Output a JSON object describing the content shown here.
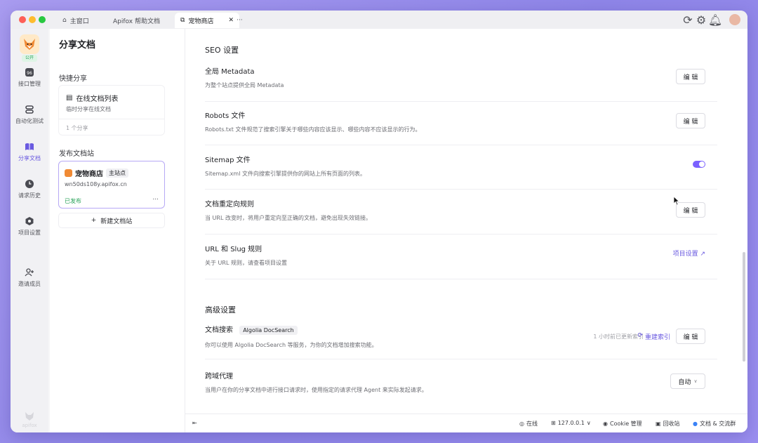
{
  "tabs": {
    "home": "主窗口",
    "help": "Apifox 帮助文档",
    "shop": "宠物商店"
  },
  "rail": {
    "badge": "公开",
    "items": [
      "接口管理",
      "自动化测试",
      "分享文档",
      "请求历史",
      "项目设置",
      "邀请成员"
    ],
    "footer": "apifox"
  },
  "sidebar": {
    "title": "分享文档",
    "quick_share": "快捷分享",
    "online_list_title": "在线文档列表",
    "online_list_desc": "临时分享在线文档",
    "share_count": "1 个分享",
    "publish_title": "发布文档站",
    "site_name": "宠物商店",
    "site_badge": "主站点",
    "site_url": "wn50ds108y.apifox.cn",
    "site_status": "已发布",
    "more": "...",
    "new_site": "新建文档站"
  },
  "main": {
    "seo_title": "SEO 设置",
    "rows": [
      {
        "title": "全局 Metadata",
        "desc": "为整个站点提供全局 Metadata",
        "action": "编 辑"
      },
      {
        "title": "Robots 文件",
        "desc": "Robots.txt 文件规范了搜索引擎关于哪些内容应该显示、哪些内容不应该显示的行为。",
        "action": "编 辑"
      },
      {
        "title": "Sitemap 文件",
        "desc": "Sitemap.xml 文件向搜索引擎提供你的网站上所有页面的列表。",
        "toggle": true
      },
      {
        "title": "文档重定向规则",
        "desc": "当 URL 改变时，将用户重定向至正确的文档，避免出现失效链接。",
        "action": "编 辑"
      },
      {
        "title": "URL 和 Slug 规则",
        "desc": "关于 URL 规则，请查看项目设置",
        "link": "项目设置 ↗"
      }
    ],
    "advanced_title": "高级设置",
    "search_title": "文档搜索",
    "search_tag": "Algolia DocSearch",
    "search_desc": "你可以使用 Algolia DocSearch 等服务，为你的文档增加搜索功能。",
    "search_updated": "1 小时前已更新索引",
    "search_reindex": "重建索引",
    "search_action": "编 辑",
    "proxy_title": "跨域代理",
    "proxy_desc": "当用户在你的分享文档中进行接口请求时，使用指定的请求代理 Agent 来实际发起请求。",
    "proxy_value": "自动"
  },
  "status": {
    "online": "在线",
    "ip": "127.0.0.1",
    "cookie": "Cookie 管理",
    "recycle": "回收站",
    "docs": "文档 & 交流群"
  },
  "colors": {
    "accent": "#6a5ae0",
    "toggle_on": "#7b61ff"
  }
}
